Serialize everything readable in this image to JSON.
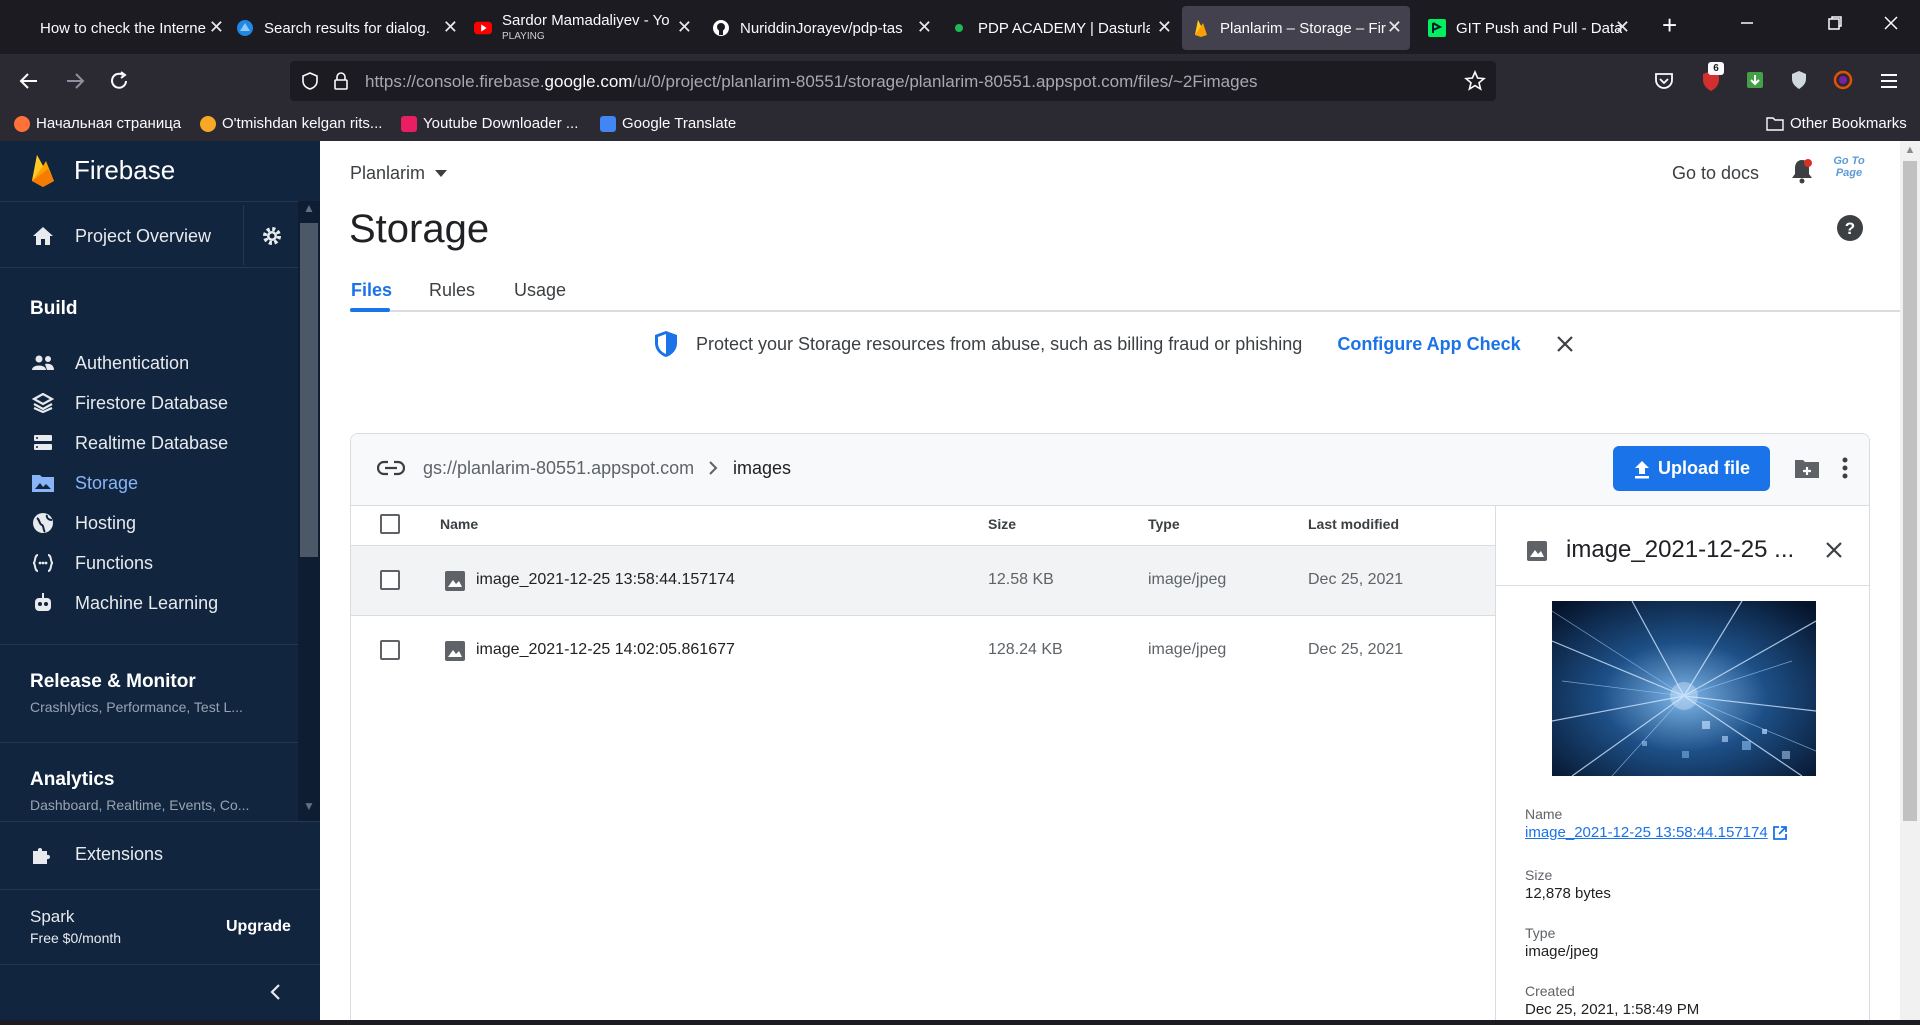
{
  "browser": {
    "tabs": [
      {
        "title": "How to check the Interne",
        "sub": ""
      },
      {
        "title": "Search results for dialog.",
        "sub": ""
      },
      {
        "title": "Sardor Mamadaliyev - Yo",
        "sub": "PLAYING"
      },
      {
        "title": "NuriddinJorayev/pdp-tas",
        "sub": ""
      },
      {
        "title": "PDP ACADEMY | Dasturla",
        "sub": ""
      },
      {
        "title": "Planlarim – Storage – Fir",
        "sub": ""
      },
      {
        "title": "GIT Push and Pull - DataC",
        "sub": ""
      }
    ],
    "url_prefix": "https://console.firebase.",
    "url_domain": "google.com",
    "url_path": "/u/0/project/planlarim-80551/storage/planlarim-80551.appspot.com/files/~2Fimages",
    "badge_count": "6",
    "bookmarks": [
      "Начальная страница",
      "O'tmishdan kelgan rits...",
      "Youtube Downloader ...",
      "Google Translate"
    ],
    "other_bookmarks": "Other Bookmarks"
  },
  "sidebar": {
    "brand": "Firebase",
    "project_overview": "Project Overview",
    "build_heading": "Build",
    "build_items": [
      "Authentication",
      "Firestore Database",
      "Realtime Database",
      "Storage",
      "Hosting",
      "Functions",
      "Machine Learning"
    ],
    "release_title": "Release & Monitor",
    "release_sub": "Crashlytics, Performance, Test L...",
    "analytics_title": "Analytics",
    "analytics_sub": "Dashboard, Realtime, Events, Co...",
    "extensions": "Extensions",
    "plan_name": "Spark",
    "plan_price": "Free $0/month",
    "upgrade": "Upgrade"
  },
  "header": {
    "project": "Planlarim",
    "go_to_docs": "Go to docs",
    "page_title": "Storage",
    "avatar_text": "Go To Page",
    "tabs": [
      "Files",
      "Rules",
      "Usage"
    ]
  },
  "banner": {
    "text": "Protect your Storage resources from abuse, such as billing fraud or phishing",
    "action": "Configure App Check"
  },
  "files": {
    "bucket": "gs://planlarim-80551.appspot.com",
    "folder": "images",
    "upload": "Upload file",
    "columns": [
      "Name",
      "Size",
      "Type",
      "Last modified"
    ],
    "rows": [
      {
        "name": "image_2021-12-25 13:58:44.157174",
        "size": "12.58 KB",
        "type": "image/jpeg",
        "modified": "Dec 25, 2021"
      },
      {
        "name": "image_2021-12-25 14:02:05.861677",
        "size": "128.24 KB",
        "type": "image/jpeg",
        "modified": "Dec 25, 2021"
      }
    ]
  },
  "details": {
    "title": "image_2021-12-25 ...",
    "name_label": "Name",
    "name_value": "image_2021-12-25 13:58:44.157174",
    "size_label": "Size",
    "size_value": "12,878 bytes",
    "type_label": "Type",
    "type_value": "image/jpeg",
    "created_label": "Created",
    "created_value": "Dec 25, 2021, 1:58:49 PM"
  },
  "colors": {
    "accent": "#1a73e8",
    "sidebar_bg": "#11253f",
    "firebase_orange": "#ffa000"
  }
}
